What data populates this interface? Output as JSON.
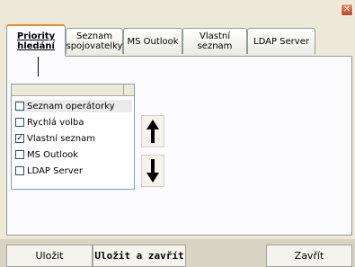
{
  "title_bar": {
    "close_glyph": "✕"
  },
  "tabs": [
    {
      "label": "Priority hledání"
    },
    {
      "label": "Seznam spojovatelky"
    },
    {
      "label": "MS Outlook"
    },
    {
      "label": "Vlastní seznam"
    },
    {
      "label": "LDAP Server"
    }
  ],
  "list": {
    "items": [
      {
        "label": "Seznam operátorky",
        "checked": false
      },
      {
        "label": "Rychlá volba",
        "checked": false
      },
      {
        "label": "Vlastní seznam",
        "checked": true
      },
      {
        "label": "MS Outlook",
        "checked": false
      },
      {
        "label": "LDAP Server",
        "checked": false
      }
    ]
  },
  "buttons": {
    "save": "Uložit",
    "save_close": "Uložit a zavřít",
    "close": "Zavřít"
  }
}
